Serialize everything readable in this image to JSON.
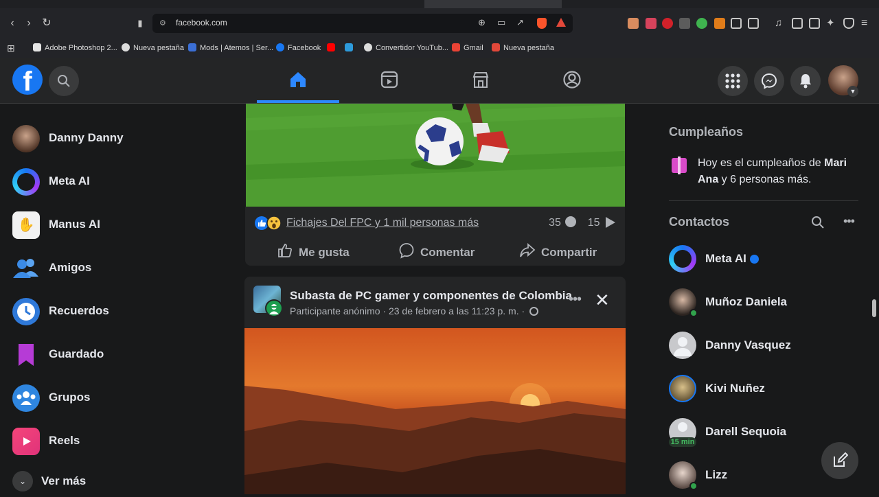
{
  "browser": {
    "url": "facebook.com",
    "bookmarks": [
      {
        "label": "Adobe Photoshop 2...",
        "color": "#e5e5e5"
      },
      {
        "label": "Nueva pestaña",
        "color": "#dcdcdc"
      },
      {
        "label": "Mods | Atemos | Ser...",
        "color": "#3b6fd6"
      },
      {
        "label": "Facebook",
        "color": "#1877f2"
      },
      {
        "label": "",
        "color": "#ff0000"
      },
      {
        "label": "",
        "color": "#2d9bdc"
      },
      {
        "label": "Convertidor YouTub...",
        "color": "#dcdcdc"
      },
      {
        "label": "Gmail",
        "color": "#ea4335"
      },
      {
        "label": "Nueva pestaña",
        "color": "#e2483a"
      }
    ]
  },
  "left_nav": [
    {
      "label": "Danny Danny",
      "icon": "profile-avatar"
    },
    {
      "label": "Meta AI",
      "icon": "meta-ai-icon"
    },
    {
      "label": "Manus AI",
      "icon": "manus-ai-icon"
    },
    {
      "label": "Amigos",
      "icon": "friends-icon"
    },
    {
      "label": "Recuerdos",
      "icon": "memories-icon"
    },
    {
      "label": "Guardado",
      "icon": "saved-icon"
    },
    {
      "label": "Grupos",
      "icon": "groups-icon"
    },
    {
      "label": "Reels",
      "icon": "reels-icon"
    },
    {
      "label": "Ver más",
      "icon": "chevron-down-icon"
    }
  ],
  "post1": {
    "reactions_text": "Fichajes Del FPC y 1 mil personas más",
    "comments": "35",
    "shares": "15",
    "like_label": "Me gusta",
    "comment_label": "Comentar",
    "share_label": "Compartir"
  },
  "post2": {
    "group": "Subasta de PC gamer y componentes de Colombia",
    "meta": "Participante anónimo · 23 de febrero a las 11:23 p. m. ·"
  },
  "right": {
    "birthdays_title": "Cumpleaños",
    "birthday_prefix": "Hoy es el cumpleaños de ",
    "birthday_name": "Mari Ana",
    "birthday_suffix": " y 6 personas más.",
    "contacts_title": "Contactos",
    "contacts": [
      {
        "name": "Meta AI",
        "verified": true
      },
      {
        "name": "Muñoz Daniela",
        "online": true
      },
      {
        "name": "Danny Vasquez"
      },
      {
        "name": "Kivi Nuñez"
      },
      {
        "name": "Darell Sequoia",
        "badge": "15 min"
      },
      {
        "name": "Lizz",
        "online": true
      }
    ]
  },
  "colors": {
    "brand": "#1877f2",
    "accent": "#2d88ff",
    "bg": "#18191a",
    "card": "#242526"
  }
}
